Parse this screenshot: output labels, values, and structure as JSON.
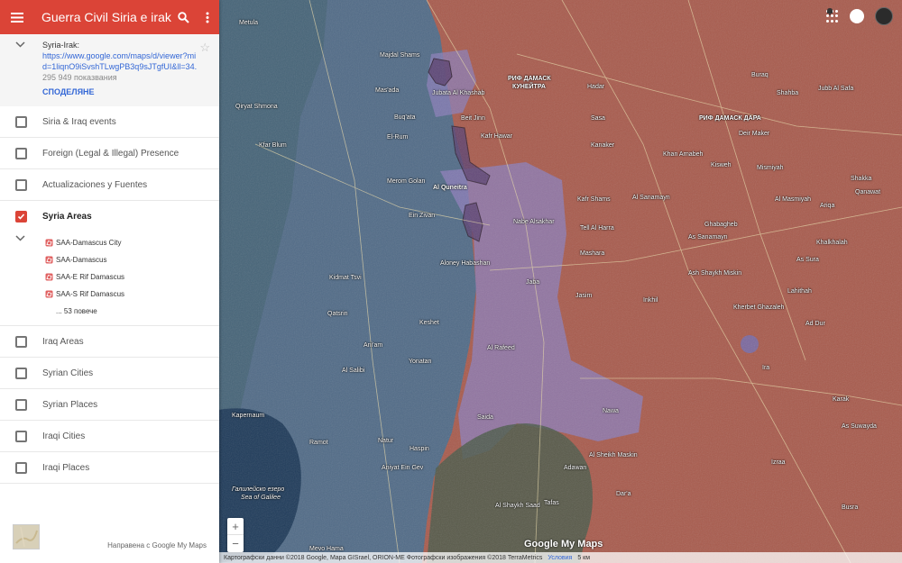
{
  "app": {
    "title": "Guerra Civil Siria e irak"
  },
  "map_info": {
    "name": "Syria-Irak:",
    "link": "https://www.google.com/maps/d/viewer?mid=1liqnO9iSvshTLwgPB3q9sJTgfUI&ll=34.",
    "views": "295 949 показвания",
    "share_label": "СПОДЕЛЯНЕ"
  },
  "layers": [
    {
      "label": "Siria & Iraq events",
      "checked": false
    },
    {
      "label": "Foreign (Legal & Illegal) Presence",
      "checked": false
    },
    {
      "label": "Actualizaciones y Fuentes",
      "checked": false
    },
    {
      "label": "Syria Areas",
      "checked": true
    }
  ],
  "sub_items": [
    {
      "label": "SAA-Damascus City"
    },
    {
      "label": "SAA-Damascus"
    },
    {
      "label": "SAA-E Rif Damascus"
    },
    {
      "label": "SAA-S Rif Damascus"
    }
  ],
  "more_label": "... 53 повече",
  "layers_after": [
    {
      "label": "Iraq Areas"
    },
    {
      "label": "Syrian Cities"
    },
    {
      "label": "Syrian Places"
    },
    {
      "label": "Iraqi Cities"
    },
    {
      "label": "Iraqi Places"
    }
  ],
  "footer": {
    "credit": "Направена с Google My Maps"
  },
  "map": {
    "logo": "Google My Maps",
    "attribution": "Картографски данни ©2018 Google, Mapa GISrael, ORION-ME Фотографски изображения ©2018 TerraMetrics",
    "terms": "Условия",
    "scale": "5 км",
    "zoom_in": "+",
    "zoom_out": "−",
    "labels": {
      "l1": "Metula",
      "l2": "Majdal Shams",
      "l3": "Qiryat Shmona",
      "l4": "Kfar Blum",
      "l5": "Mas'ada",
      "l6": "Buq'ata",
      "l7": "El-Rum",
      "l8": "Merom Golan",
      "l9": "Al Quneitra",
      "l10": "Ein Zivan",
      "l11": "Aloney Habashan",
      "l12": "Kidmat Tsvi",
      "l13": "Qatsrin",
      "l14": "Keshet",
      "l15": "Yonatan",
      "l16": "Ani'am",
      "l17": "Al Salibi",
      "l18": "Kapernaum",
      "l19": "Ramot",
      "l20": "Natur",
      "l21": "Haspin",
      "l22": "Aniyat Ein Gev",
      "l23": "Галилейско езеро",
      "l24": "Sea of Galilee",
      "l25": "Mevo Hama",
      "l26": "Jubata Al Khashab",
      "l27": "Beit Jinn",
      "l28": "Kafr Hawar",
      "l29": "РИФ ДАМАСК",
      "l30": "КУНЕЙТРА",
      "l31": "Hadar",
      "l32": "Nabe Alsakhar",
      "l33": "Jaba",
      "l34": "Al Rafeed",
      "l35": "Saida",
      "l36": "Nawa",
      "l37": "Al Sheikh Maskin",
      "l38": "Adawan",
      "l39": "Al Shaykh Saad",
      "l40": "Tafas",
      "l41": "Dar'a",
      "l42": "Izraa",
      "l43": "Kafr Shams",
      "l44": "Al Sanamayn",
      "l45": "Ghabagheb",
      "l46": "As Sanamayn",
      "l47": "Kanaker",
      "l48": "Sasa",
      "l49": "Khan Arnabeh",
      "l50": "Deir Maker",
      "l51": "Kisweh",
      "l52": "Mismiyah",
      "l53": "Shahba",
      "l54": "Buraq",
      "l55": "Al Masmiyah",
      "l56": "РИФ ДАМАСК ДАРА",
      "l57": "Ash Shaykh Miskin",
      "l58": "Tell Al Harra",
      "l59": "Mashara",
      "l60": "Jasim",
      "l61": "Inkhil",
      "l62": "Kherbet Ghazaleh",
      "l63": "Khalkhalah",
      "l64": "As Sura",
      "l65": "Lahithah",
      "l66": "Ad Dur",
      "l67": "Ira",
      "l68": "Busra",
      "l69": "Karak",
      "l70": "Ariqa",
      "l71": "Shakka",
      "l72": "As Suwayda",
      "l73": "Qanawat",
      "l74": "Jubb Al Safa"
    }
  },
  "colors": {
    "header": "#db4437",
    "link": "#3367d6",
    "checkbox_on": "#db4437"
  }
}
